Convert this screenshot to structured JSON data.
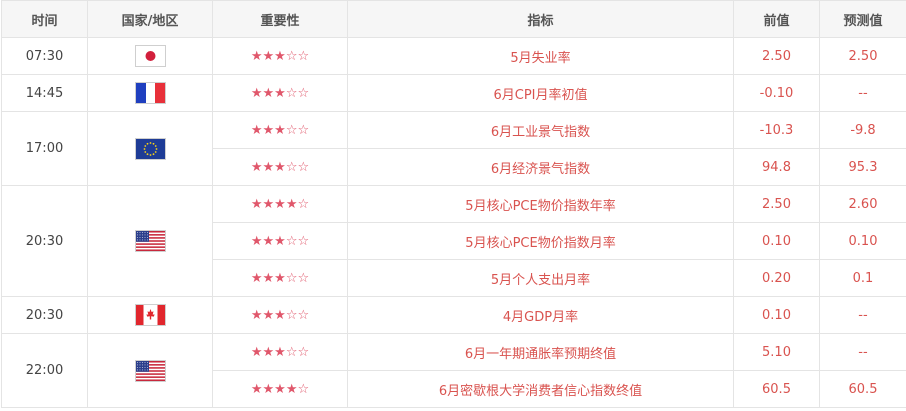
{
  "header": {
    "time": "时间",
    "country": "国家/地区",
    "importance": "重要性",
    "indicator": "指标",
    "previous": "前值",
    "forecast": "预测值"
  },
  "groups": [
    {
      "time": "07:30",
      "flag_icon": "japan-flag-icon",
      "rows": [
        {
          "stars": 3,
          "indicator": "5月失业率",
          "previous": "2.50",
          "forecast": "2.50"
        }
      ]
    },
    {
      "time": "14:45",
      "flag_icon": "france-flag-icon",
      "rows": [
        {
          "stars": 3,
          "indicator": "6月CPI月率初值",
          "previous": "-0.10",
          "forecast": "--"
        }
      ]
    },
    {
      "time": "17:00",
      "flag_icon": "eu-flag-icon",
      "rows": [
        {
          "stars": 3,
          "indicator": "6月工业景气指数",
          "previous": "-10.3",
          "forecast": "-9.8"
        },
        {
          "stars": 3,
          "indicator": "6月经济景气指数",
          "previous": "94.8",
          "forecast": "95.3"
        }
      ]
    },
    {
      "time": "20:30",
      "flag_icon": "usa-flag-icon",
      "rows": [
        {
          "stars": 4,
          "indicator": "5月核心PCE物价指数年率",
          "previous": "2.50",
          "forecast": "2.60"
        },
        {
          "stars": 3,
          "indicator": "5月核心PCE物价指数月率",
          "previous": "0.10",
          "forecast": "0.10"
        },
        {
          "stars": 3,
          "indicator": "5月个人支出月率",
          "previous": "0.20",
          "forecast": "0.1"
        }
      ]
    },
    {
      "time": "20:30",
      "flag_icon": "canada-flag-icon",
      "rows": [
        {
          "stars": 3,
          "indicator": "4月GDP月率",
          "previous": "0.10",
          "forecast": "--"
        }
      ]
    },
    {
      "time": "22:00",
      "flag_icon": "usa-flag-icon",
      "rows": [
        {
          "stars": 3,
          "indicator": "6月一年期通胀率预期终值",
          "previous": "5.10",
          "forecast": "--"
        },
        {
          "stars": 4,
          "indicator": "6月密歇根大学消费者信心指数终值",
          "previous": "60.5",
          "forecast": "60.5"
        }
      ]
    }
  ],
  "star_max": 5,
  "colors": {
    "accent": "#d9534f",
    "star": "#e0576b",
    "header_bg": "#f6f6f6",
    "border": "#e4e4e4"
  }
}
